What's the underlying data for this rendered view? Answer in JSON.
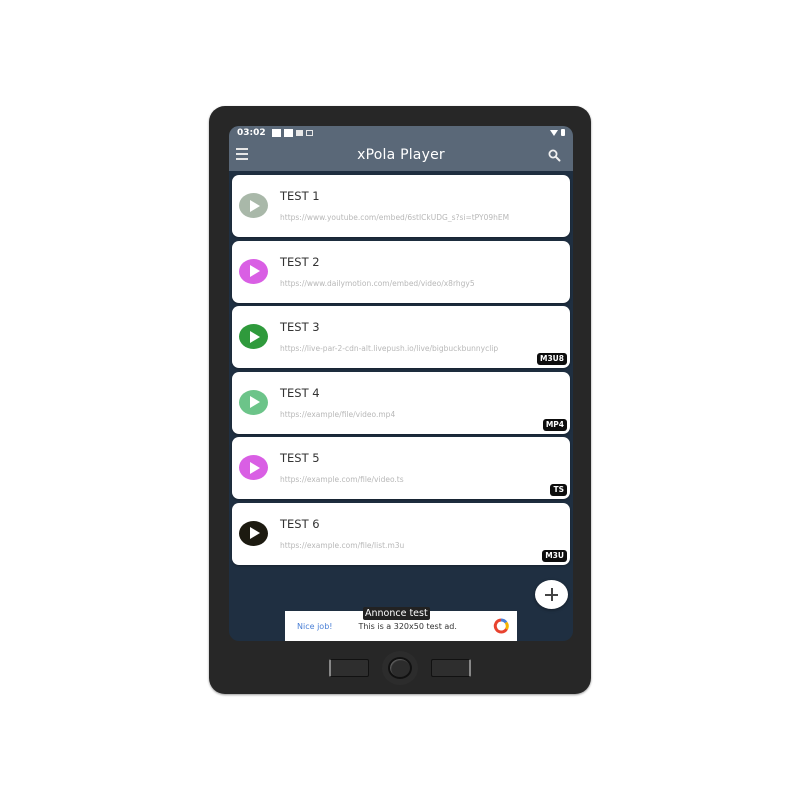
{
  "status_bar": {
    "time": "03:02",
    "icons": [
      "notification-icon",
      "notification-icon",
      "notification-small-icon",
      "image-icon"
    ],
    "right_icons": [
      "wifi-icon",
      "battery-icon"
    ]
  },
  "app_bar": {
    "title": "xPola Player",
    "left_icon": "menu-icon",
    "right_icon": "search-icon"
  },
  "colors": {
    "app_bar": "#5a6878",
    "background": "#1f2f41",
    "badge": "#0d0d0d"
  },
  "items": [
    {
      "name": "TEST 1",
      "url": "https://www.youtube.com/embed/6stICkUDG_s?si=tPY09hEM",
      "badge": null,
      "icon_color": "#a9b8a9"
    },
    {
      "name": "TEST 2",
      "url": "https://www.dailymotion.com/embed/video/x8rhgy5",
      "badge": null,
      "icon_color": "#d95fe4"
    },
    {
      "name": "TEST 3",
      "url": "https://live-par-2-cdn-alt.livepush.io/live/bigbuckbunnyclip",
      "badge": "M3U8",
      "icon_color": "#2f9a3c"
    },
    {
      "name": "TEST 4",
      "url": "https://example/file/video.mp4",
      "badge": "MP4",
      "icon_color": "#6cc489"
    },
    {
      "name": "TEST 5",
      "url": "https://example.com/file/video.ts",
      "badge": "TS",
      "icon_color": "#d95fe4"
    },
    {
      "name": "TEST 6",
      "url": "https://example.com/file/list.m3u",
      "badge": "M3U",
      "icon_color": "#1c1a10"
    }
  ],
  "fab": {
    "icon": "plus-icon"
  },
  "ad": {
    "label": "Annonce test",
    "headline": "Nice job!",
    "description": "This is a 320x50 test ad."
  }
}
